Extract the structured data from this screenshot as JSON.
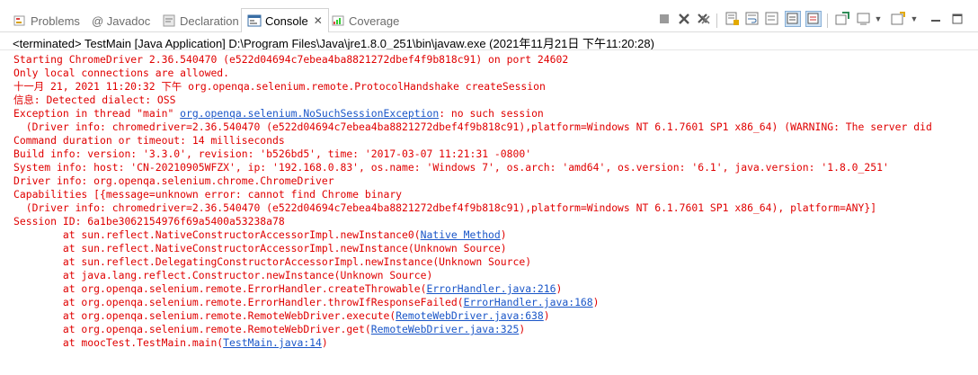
{
  "tabs": [
    {
      "label": "Problems",
      "icon": "problems-icon"
    },
    {
      "label": "@ Javadoc",
      "icon": ""
    },
    {
      "label": "Declaration",
      "icon": "declaration-icon"
    },
    {
      "label": "Console",
      "icon": "console-icon",
      "close": "✕"
    },
    {
      "label": "Coverage",
      "icon": "coverage-icon"
    }
  ],
  "status": "<terminated> TestMain [Java Application] D:\\Program Files\\Java\\jre1.8.0_251\\bin\\javaw.exe (2021年11月21日 下午11:20:28)",
  "console": {
    "lines": [
      {
        "pre": "Starting ChromeDriver 2.36.540470 (e522d04694c7ebea4ba8821272dbef4f9b818c91) on port 24602"
      },
      {
        "pre": "Only local connections are allowed."
      },
      {
        "pre": "十一月 21, 2021 11:20:32 下午 org.openqa.selenium.remote.ProtocolHandshake createSession"
      },
      {
        "pre": "信息: Detected dialect: OSS"
      },
      {
        "pre": "Exception in thread \"main\" ",
        "link": "org.openqa.selenium.NoSuchSessionException",
        "post": ": no such session"
      },
      {
        "pre": "  (Driver info: chromedriver=2.36.540470 (e522d04694c7ebea4ba8821272dbef4f9b818c91),platform=Windows NT 6.1.7601 SP1 x86_64) (WARNING: The server did"
      },
      {
        "pre": "Command duration or timeout: 14 milliseconds"
      },
      {
        "pre": "Build info: version: '3.3.0', revision: 'b526bd5', time: '2017-03-07 11:21:31 -0800'"
      },
      {
        "pre": "System info: host: 'CN-20210905WFZX', ip: '192.168.0.83', os.name: 'Windows 7', os.arch: 'amd64', os.version: '6.1', java.version: '1.8.0_251'"
      },
      {
        "pre": "Driver info: org.openqa.selenium.chrome.ChromeDriver"
      },
      {
        "pre": "Capabilities [{message=unknown error: cannot find Chrome binary"
      },
      {
        "pre": "  (Driver info: chromedriver=2.36.540470 (e522d04694c7ebea4ba8821272dbef4f9b818c91),platform=Windows NT 6.1.7601 SP1 x86_64), platform=ANY}]"
      },
      {
        "pre": "Session ID: 6a1be3062154976f69a5400a53238a78"
      },
      {
        "pre": "\tat sun.reflect.NativeConstructorAccessorImpl.newInstance0(",
        "link": "Native Method",
        "post": ")"
      },
      {
        "pre": "\tat sun.reflect.NativeConstructorAccessorImpl.newInstance(Unknown Source)"
      },
      {
        "pre": "\tat sun.reflect.DelegatingConstructorAccessorImpl.newInstance(Unknown Source)"
      },
      {
        "pre": "\tat java.lang.reflect.Constructor.newInstance(Unknown Source)"
      },
      {
        "pre": "\tat org.openqa.selenium.remote.ErrorHandler.createThrowable(",
        "link": "ErrorHandler.java:216",
        "post": ")"
      },
      {
        "pre": "\tat org.openqa.selenium.remote.ErrorHandler.throwIfResponseFailed(",
        "link": "ErrorHandler.java:168",
        "post": ")"
      },
      {
        "pre": "\tat org.openqa.selenium.remote.RemoteWebDriver.execute(",
        "link": "RemoteWebDriver.java:638",
        "post": ")"
      },
      {
        "pre": "\tat org.openqa.selenium.remote.RemoteWebDriver.get(",
        "link": "RemoteWebDriver.java:325",
        "post": ")"
      },
      {
        "pre": "\tat moocTest.TestMain.main(",
        "link": "TestMain.java:14",
        "post": ")"
      }
    ]
  },
  "colors": {
    "error_text": "#e00000",
    "link": "#1a56c8"
  }
}
